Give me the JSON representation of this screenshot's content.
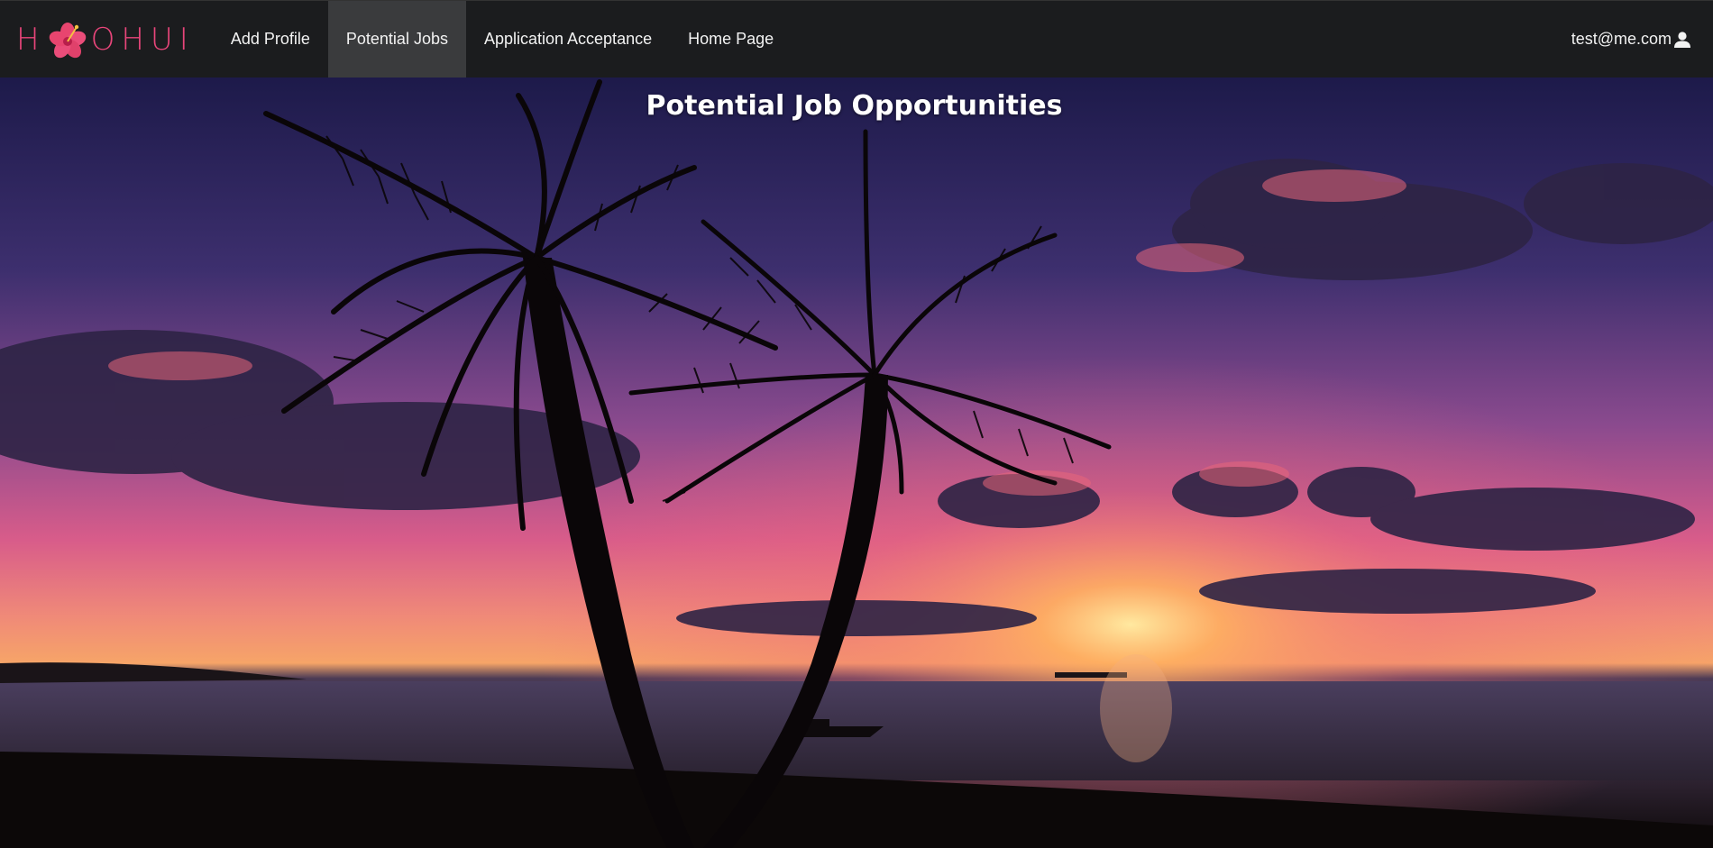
{
  "brand": {
    "logo_text_left": "H",
    "logo_text_right": "OHUI",
    "accent": "#e8457a"
  },
  "nav": {
    "items": [
      {
        "label": "Add Profile"
      },
      {
        "label": "Potential Jobs",
        "active": true
      },
      {
        "label": "Application Acceptance"
      },
      {
        "label": "Home Page"
      }
    ],
    "user": {
      "email": "test@me.com",
      "icon": "user-icon"
    }
  },
  "hero": {
    "title": "Potential Job Opportunities",
    "background": "tropical sunset with palm trees"
  },
  "colors": {
    "navbar": "#1b1c1e",
    "active_tab": "#3a3b3d",
    "text": "#f2f2f2"
  }
}
